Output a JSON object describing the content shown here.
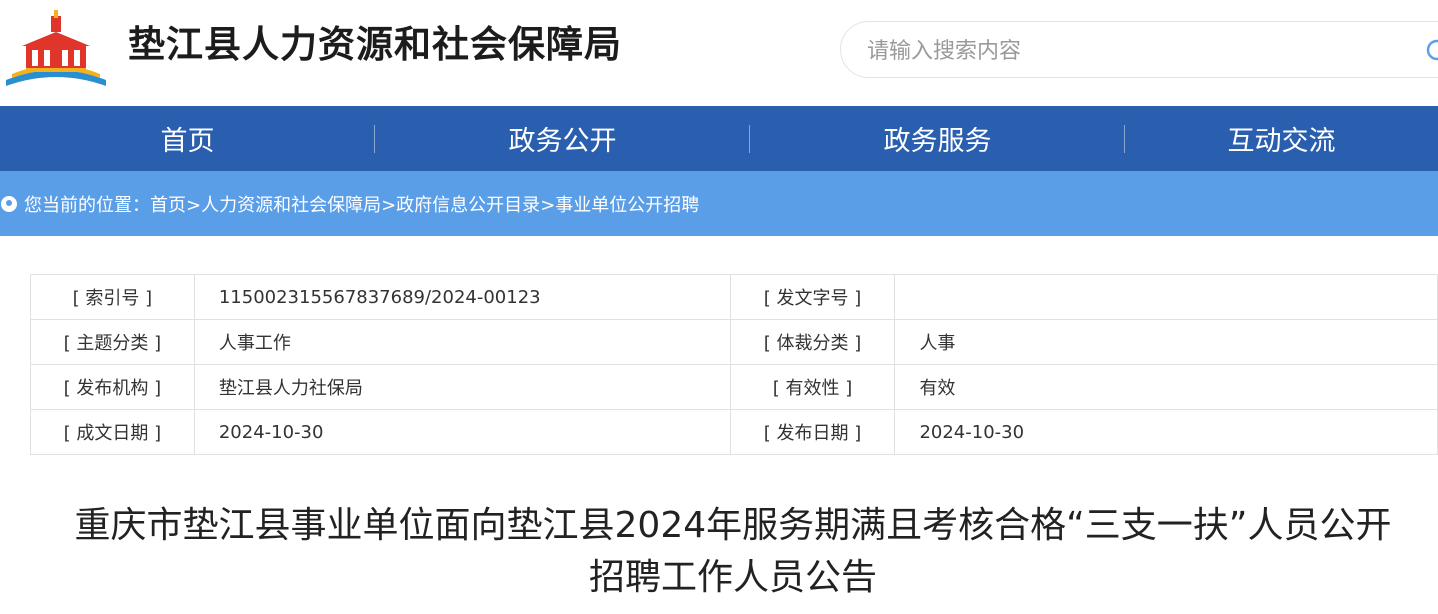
{
  "header": {
    "site_title": "垫江县人力资源和社会保障局",
    "search_placeholder": "请输入搜索内容",
    "logo_icon": "government-building-icon"
  },
  "nav": {
    "items": [
      {
        "label": "首页"
      },
      {
        "label": "政务公开"
      },
      {
        "label": "政务服务"
      },
      {
        "label": "互动交流"
      }
    ]
  },
  "breadcrumb": {
    "prefix": "您当前的位置：",
    "items": [
      "首页",
      " >人力资源和社会保障局",
      " >政府信息公开目录",
      " >事业单位公开招聘"
    ]
  },
  "meta": {
    "rows": [
      {
        "k1": "[ 索引号 ]",
        "v1": "11500231556783768​9/2024-00123",
        "k2": "[ 发文字号 ]",
        "v2": ""
      },
      {
        "k1": "[ 主题分类 ]",
        "v1": "人事工作",
        "k2": "[ 体裁分类 ]",
        "v2": "人事"
      },
      {
        "k1": "[ 发布机构 ]",
        "v1": "垫江县人力社保局",
        "k2": "[ 有效性 ]",
        "v2": "有效"
      },
      {
        "k1": "[ 成文日期 ]",
        "v1": "2024-10-30",
        "k2": "[ 发布日期 ]",
        "v2": "2024-10-30"
      }
    ]
  },
  "article": {
    "title_line1": "重庆市垫江县事业单位面向垫江县2024年服务期满且考核合格“三支一扶”人员公开",
    "title_line2": "招聘工作人员公告"
  },
  "colors": {
    "nav_bg": "#2a5fb0",
    "breadcrumb_bg": "#5b9ee8",
    "logo_red": "#e0352b",
    "logo_gold": "#f2b21f"
  }
}
